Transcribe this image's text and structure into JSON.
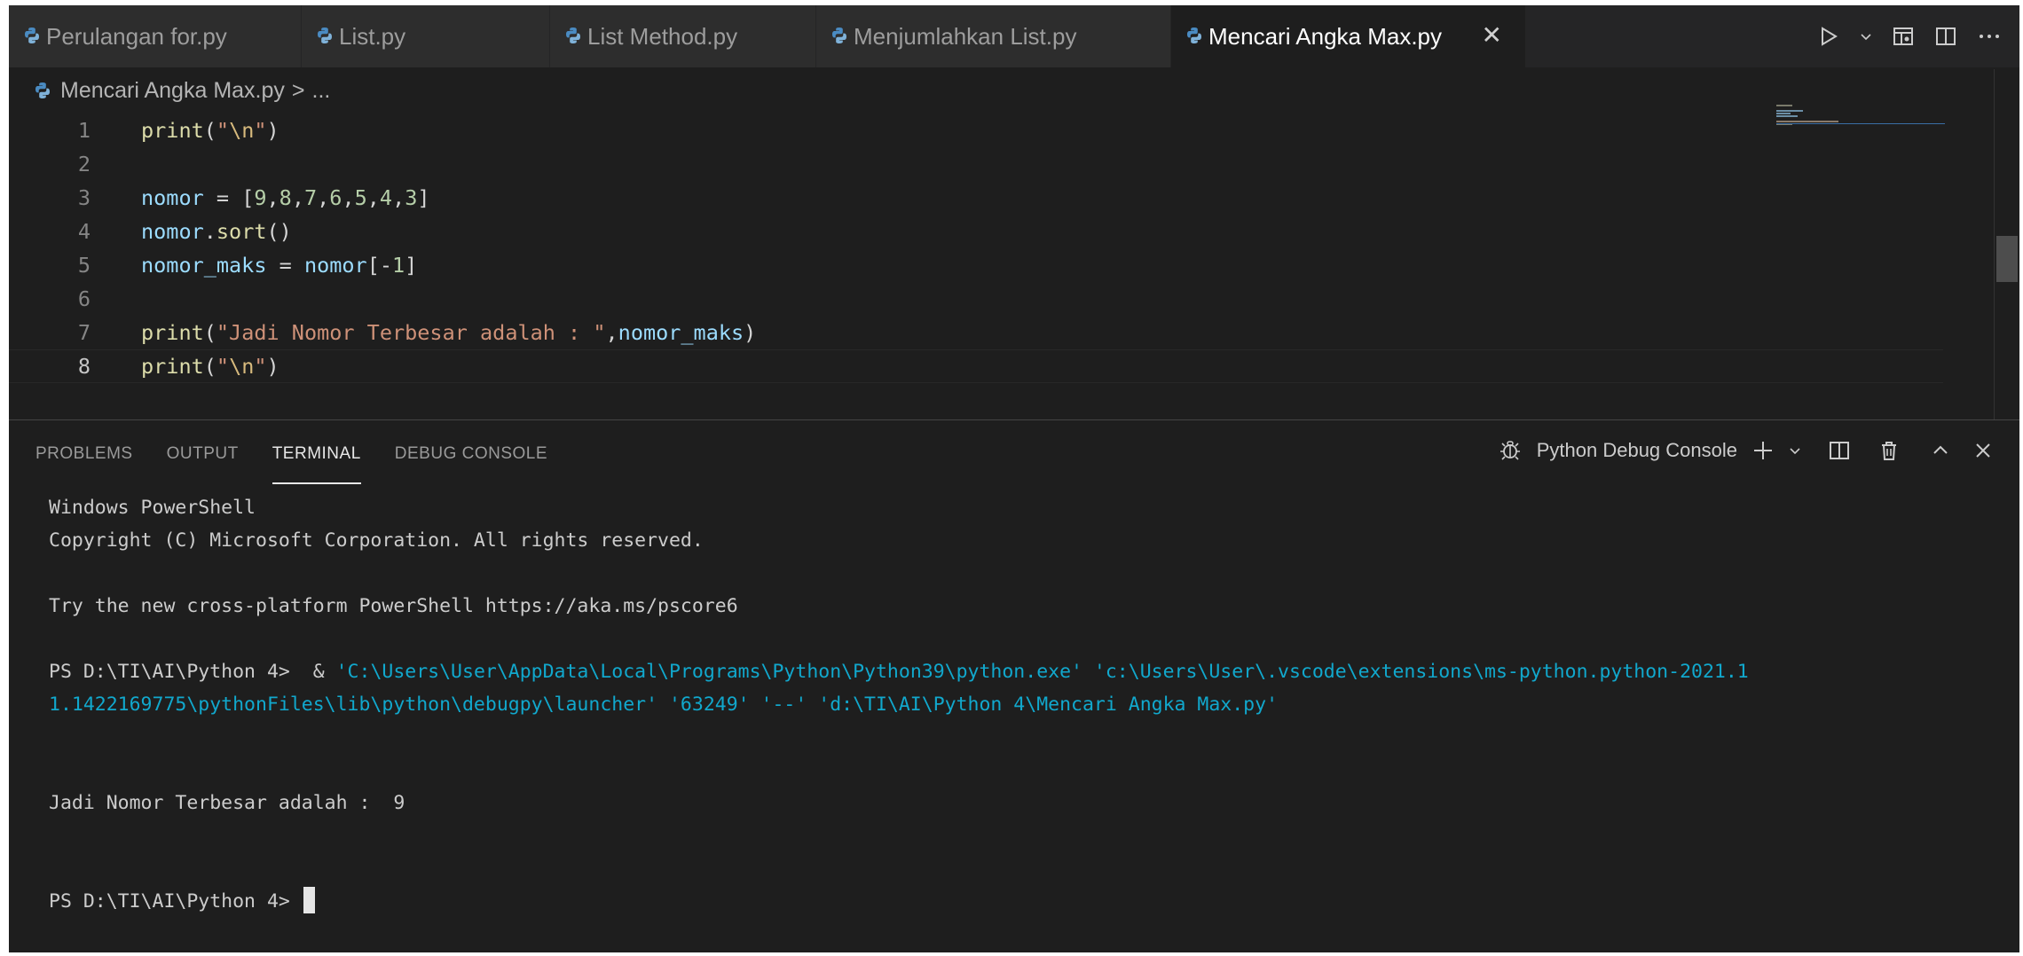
{
  "tabs": [
    {
      "label": "Perulangan for.py",
      "active": false
    },
    {
      "label": "List.py",
      "active": false
    },
    {
      "label": "List Method.py",
      "active": false
    },
    {
      "label": "Menjumlahkan List.py",
      "active": false
    },
    {
      "label": "Mencari Angka Max.py",
      "active": true
    }
  ],
  "breadcrumb": {
    "file": "Mencari Angka Max.py",
    "sep": ">",
    "rest": "..."
  },
  "editor": {
    "current_line": 8,
    "lines": [
      {
        "num": "1",
        "text": "print(\"\\n\")"
      },
      {
        "num": "2",
        "text": ""
      },
      {
        "num": "3",
        "text": "nomor = [9,8,7,6,5,4,3]"
      },
      {
        "num": "4",
        "text": "nomor.sort()"
      },
      {
        "num": "5",
        "text": "nomor_maks = nomor[-1]"
      },
      {
        "num": "6",
        "text": ""
      },
      {
        "num": "7",
        "text": "print(\"Jadi Nomor Terbesar adalah : \",nomor_maks)"
      },
      {
        "num": "8",
        "text": "print(\"\\n\")"
      }
    ]
  },
  "panel": {
    "tabs": [
      "PROBLEMS",
      "OUTPUT",
      "TERMINAL",
      "DEBUG CONSOLE"
    ],
    "active_tab": "TERMINAL",
    "terminal_name": "Python Debug Console"
  },
  "terminal": {
    "lines": [
      {
        "segments": [
          {
            "text": "Windows PowerShell"
          }
        ]
      },
      {
        "segments": [
          {
            "text": "Copyright (C) Microsoft Corporation. All rights reserved."
          }
        ]
      },
      {
        "segments": []
      },
      {
        "segments": [
          {
            "text": "Try the new cross-platform PowerShell https://aka.ms/pscore6"
          }
        ]
      },
      {
        "segments": []
      },
      {
        "segments": [
          {
            "text": "PS D:\\TI\\AI\\Python 4>  & "
          },
          {
            "text": "'C:\\Users\\User\\AppData\\Local\\Programs\\Python\\Python39\\python.exe' 'c:\\Users\\User\\.vscode\\extensions\\ms-python.python-2021.1",
            "cyan": true
          }
        ]
      },
      {
        "segments": [
          {
            "text": "1.1422169775\\pythonFiles\\lib\\python\\debugpy\\launcher' '63249' '--' 'd:\\TI\\AI\\Python 4\\Mencari Angka Max.py'",
            "cyan": true
          }
        ]
      },
      {
        "segments": []
      },
      {
        "segments": []
      },
      {
        "segments": [
          {
            "text": "Jadi Nomor Terbesar adalah :  9"
          }
        ]
      },
      {
        "segments": []
      },
      {
        "segments": []
      },
      {
        "segments": [
          {
            "text": "PS D:\\TI\\AI\\Python 4> "
          }
        ],
        "cursor": true
      }
    ]
  },
  "colors": {
    "editor_bg": "#1e1e1e",
    "tabbar_bg": "#252526",
    "function": "#dcdcaa",
    "string": "#ce9178",
    "variable": "#9cdcfe",
    "number": "#b5cea8",
    "terminal_cyan": "#11a8cd"
  },
  "icons": {
    "file": "python-file-icon",
    "run": "run-icon",
    "split": "split-editor-icon",
    "more": "more-actions-icon",
    "debug": "debug-icon",
    "add": "add-terminal-icon",
    "trash": "trash-icon"
  }
}
